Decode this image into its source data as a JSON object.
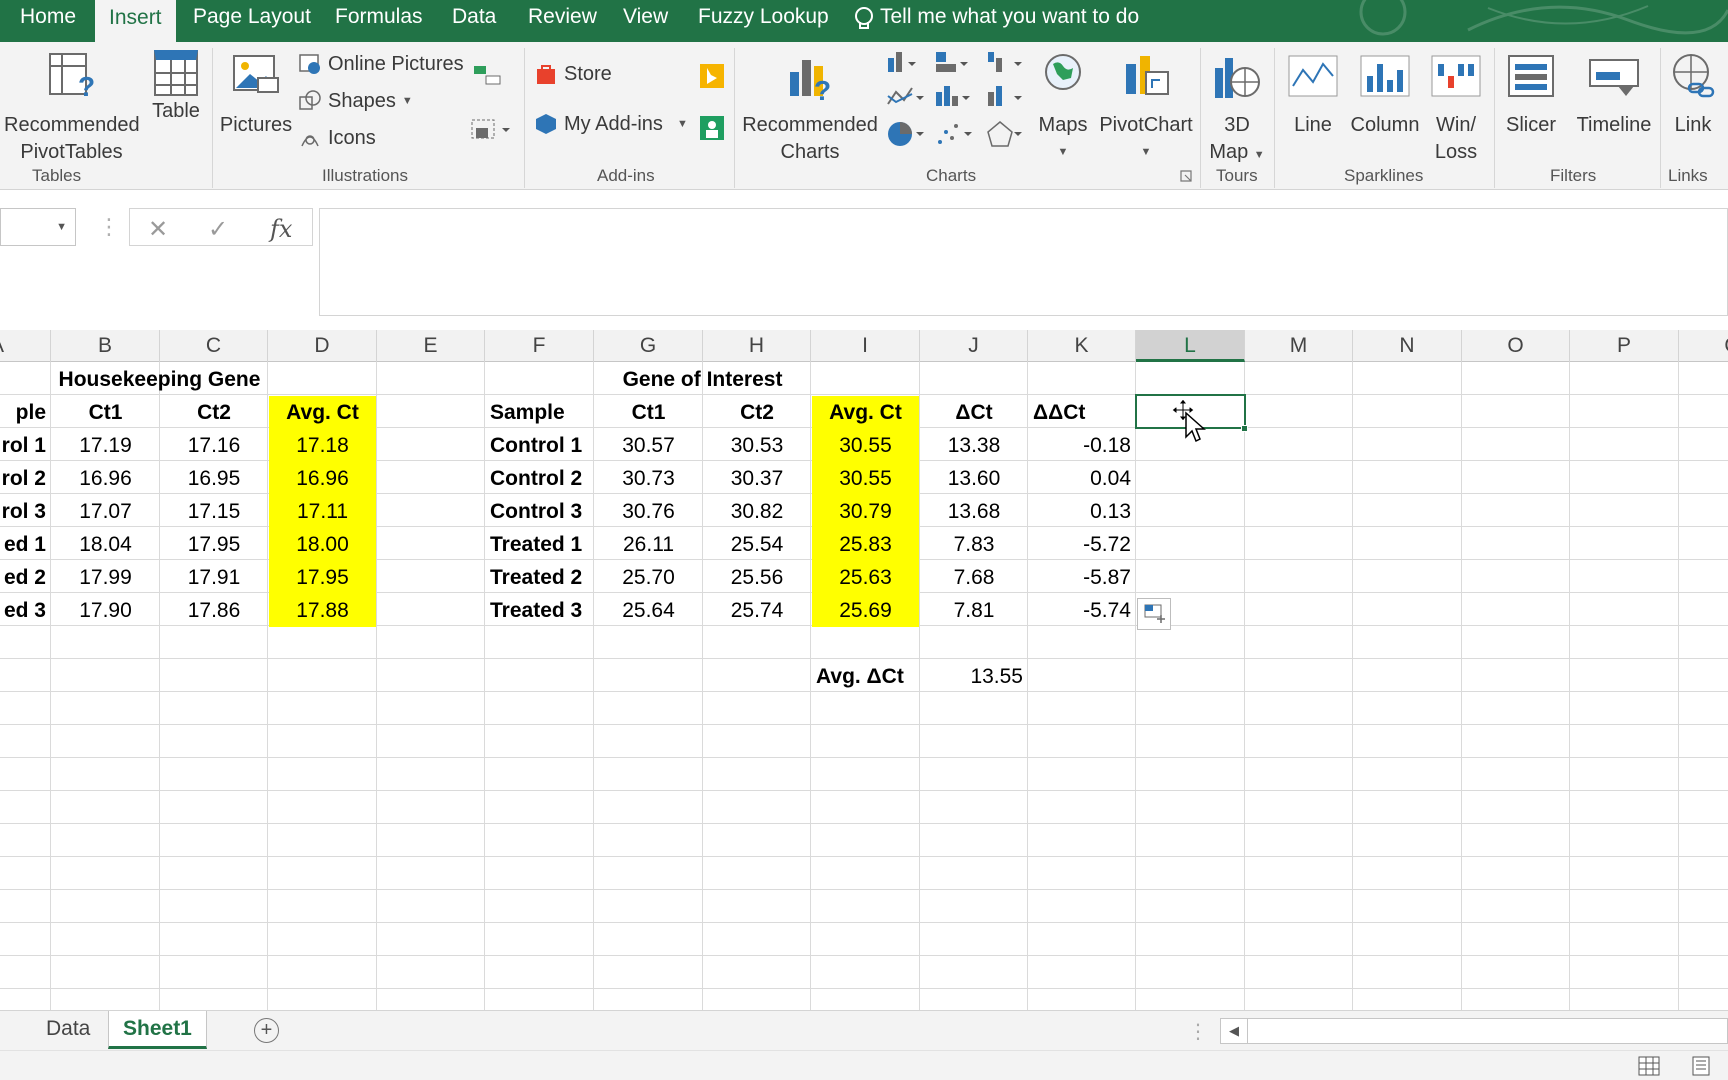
{
  "ribbon_tabs": [
    "Home",
    "Insert",
    "Page Layout",
    "Formulas",
    "Data",
    "Review",
    "View",
    "Fuzzy Lookup"
  ],
  "active_tab": "Insert",
  "tell_me": "Tell me what you want to do",
  "ribbon": {
    "tables": {
      "label": "Tables",
      "recommended_pivot_l1": "Recommended",
      "recommended_pivot_l2": "PivotTables",
      "table": "Table"
    },
    "illustrations": {
      "label": "Illustrations",
      "pictures": "Pictures",
      "online_pictures": "Online Pictures",
      "shapes": "Shapes",
      "icons": "Icons"
    },
    "addins": {
      "label": "Add-ins",
      "store": "Store",
      "my_addins": "My Add-ins"
    },
    "charts": {
      "label": "Charts",
      "recommended_charts_l1": "Recommended",
      "recommended_charts_l2": "Charts",
      "maps": "Maps",
      "pivotchart": "PivotChart"
    },
    "tours": {
      "label": "Tours",
      "map3d_l1": "3D",
      "map3d_l2": "Map"
    },
    "sparklines": {
      "label": "Sparklines",
      "line": "Line",
      "column": "Column",
      "winloss_l1": "Win/",
      "winloss_l2": "Loss"
    },
    "filters": {
      "label": "Filters",
      "slicer": "Slicer",
      "timeline": "Timeline"
    },
    "links": {
      "label": "Links",
      "link": "Link"
    }
  },
  "formula_bar": {
    "fx": "fx",
    "value": ""
  },
  "columns": [
    "A",
    "B",
    "C",
    "D",
    "E",
    "F",
    "G",
    "H",
    "I",
    "J",
    "K",
    "L",
    "M",
    "N",
    "O",
    "P",
    "Q"
  ],
  "selected_column": "L",
  "sheet": {
    "hk_title": "Housekeeping Gene",
    "goi_title": "Gene of Interest",
    "hk_headers": [
      "ple",
      "Ct1",
      "Ct2",
      "Avg. Ct"
    ],
    "goi_headers": [
      "Sample",
      "Ct1",
      "Ct2",
      "Avg. Ct",
      "ΔCt",
      "ΔΔCt"
    ],
    "hk_rows": [
      [
        "rol 1",
        "17.19",
        "17.16",
        "17.18"
      ],
      [
        "rol 2",
        "16.96",
        "16.95",
        "16.96"
      ],
      [
        "rol 3",
        "17.07",
        "17.15",
        "17.11"
      ],
      [
        "ed 1",
        "18.04",
        "17.95",
        "18.00"
      ],
      [
        "ed 2",
        "17.99",
        "17.91",
        "17.95"
      ],
      [
        "ed 3",
        "17.90",
        "17.86",
        "17.88"
      ]
    ],
    "goi_rows": [
      [
        "Control 1",
        "30.57",
        "30.53",
        "30.55",
        "13.38",
        "-0.18"
      ],
      [
        "Control 2",
        "30.73",
        "30.37",
        "30.55",
        "13.60",
        "0.04"
      ],
      [
        "Control 3",
        "30.76",
        "30.82",
        "30.79",
        "13.68",
        "0.13"
      ],
      [
        "Treated 1",
        "26.11",
        "25.54",
        "25.83",
        "7.83",
        "-5.72"
      ],
      [
        "Treated 2",
        "25.70",
        "25.56",
        "25.63",
        "7.68",
        "-5.87"
      ],
      [
        "Treated 3",
        "25.64",
        "25.74",
        "25.69",
        "7.81",
        "-5.74"
      ]
    ],
    "avg_dct_label": "Avg. ΔCt",
    "avg_dct_value": "13.55"
  },
  "sheet_tabs": [
    "Data",
    "Sheet1"
  ],
  "active_sheet": "Sheet1",
  "colors": {
    "excel_green": "#217346",
    "highlight": "#ffff00",
    "selected_cell_border": "#217346"
  }
}
